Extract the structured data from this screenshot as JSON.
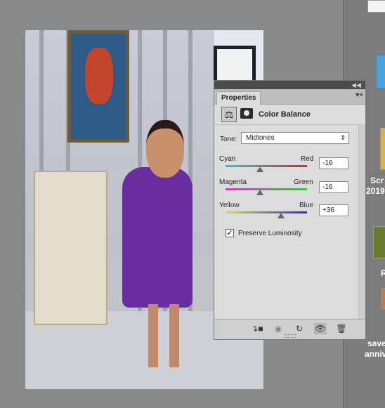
{
  "properties_panel": {
    "tab_label": "Properties",
    "title": "Color Balance",
    "tone": {
      "label": "Tone:",
      "value": "Midtones"
    },
    "sliders": [
      {
        "left": "Cyan",
        "right": "Red",
        "value": "-16",
        "level": -16
      },
      {
        "left": "Magenta",
        "right": "Green",
        "value": "-16",
        "level": -16
      },
      {
        "left": "Yellow",
        "right": "Blue",
        "value": "+36",
        "level": 36
      }
    ],
    "preserve_luminosity": {
      "label": "Preserve Luminosity",
      "checked": true
    },
    "bottom_icons": [
      "clip-to-layer-icon",
      "view-previous-state-icon",
      "reset-icon",
      "visibility-eye-icon",
      "trash-icon"
    ]
  },
  "desktop": {
    "labels": [
      "Scr",
      "2019-",
      "R",
      "save",
      "anniv"
    ]
  },
  "colors": {
    "panel_bg": "#dcdcdc",
    "dark_bar": "#4b4b4b"
  }
}
